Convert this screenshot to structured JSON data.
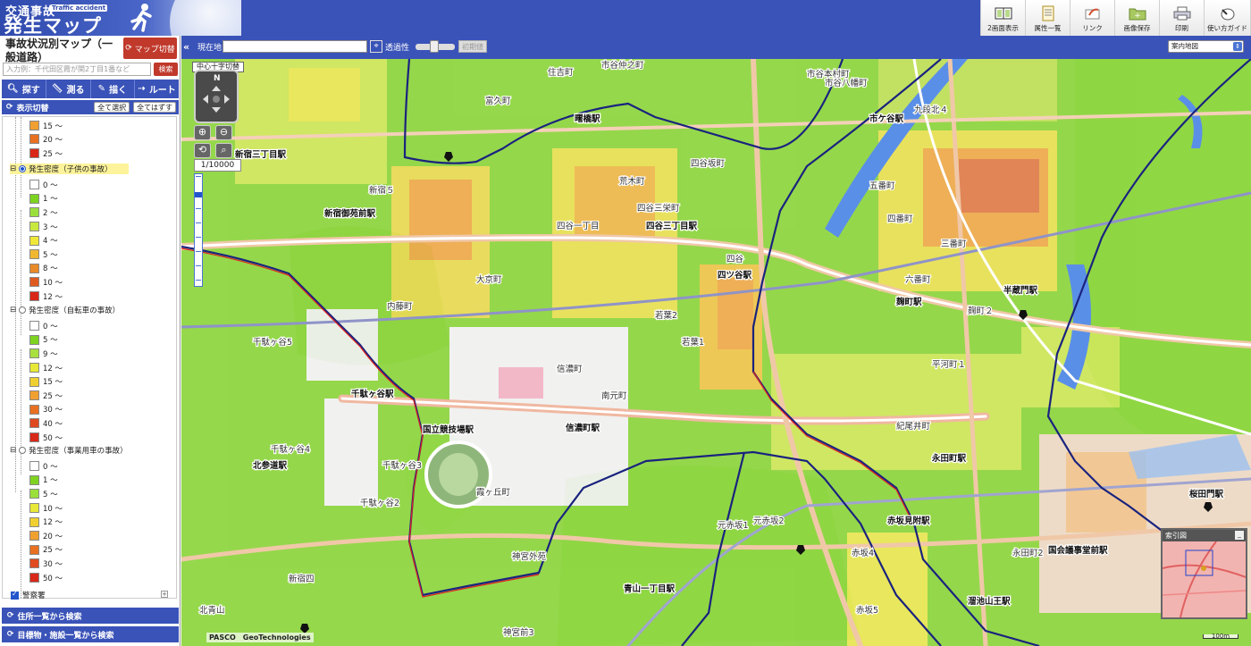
{
  "header": {
    "logo_line1": "交通事故",
    "logo_line2": "発生マップ",
    "logo_en": "Traffic accident",
    "toolbar": [
      {
        "label": "2画面表示",
        "icon": "dual-screen-icon"
      },
      {
        "label": "属性一覧",
        "icon": "attribute-list-icon"
      },
      {
        "label": "リンク",
        "icon": "link-icon"
      },
      {
        "label": "画像保存",
        "icon": "save-image-icon"
      },
      {
        "label": "印刷",
        "icon": "print-icon"
      },
      {
        "label": "使い方ガイド",
        "icon": "guide-icon"
      }
    ]
  },
  "sidebar": {
    "title": "事故状況別マップ（一般道路）",
    "map_switch_label": "マップ切替",
    "address_placeholder": "入力例：千代田区霞が関2丁目1番など",
    "search_label": "検索",
    "tools": [
      {
        "label": "探す",
        "icon": "search-icon"
      },
      {
        "label": "測る",
        "icon": "ruler-icon"
      },
      {
        "label": "描く",
        "icon": "draw-icon"
      },
      {
        "label": "ルート",
        "icon": "route-icon"
      }
    ],
    "display_toggle": {
      "label": "表示切替",
      "select_all": "全て選択",
      "deselect_all": "全てはずす"
    },
    "top_legend": [
      {
        "label": "15 〜",
        "color": "#f0a030"
      },
      {
        "label": "20 〜",
        "color": "#e87020"
      },
      {
        "label": "25 〜",
        "color": "#d82818"
      }
    ],
    "groups": [
      {
        "label": "発生密度（子供の事故）",
        "selected": true,
        "items": [
          {
            "label": "0 〜",
            "color": "#ffffff"
          },
          {
            "label": "1 〜",
            "color": "#7ed321"
          },
          {
            "label": "2 〜",
            "color": "#9be03a"
          },
          {
            "label": "3 〜",
            "color": "#c8e840"
          },
          {
            "label": "4 〜",
            "color": "#f0e838"
          },
          {
            "label": "5 〜",
            "color": "#f0b830"
          },
          {
            "label": "8 〜",
            "color": "#e88a28"
          },
          {
            "label": "10 〜",
            "color": "#e05a20"
          },
          {
            "label": "12 〜",
            "color": "#d82818"
          }
        ]
      },
      {
        "label": "発生密度（自転車の事故）",
        "selected": false,
        "items": [
          {
            "label": "0 〜",
            "color": "#ffffff"
          },
          {
            "label": "5 〜",
            "color": "#7ed321"
          },
          {
            "label": "9 〜",
            "color": "#a8e040"
          },
          {
            "label": "12 〜",
            "color": "#e8e838"
          },
          {
            "label": "15 〜",
            "color": "#f0d030"
          },
          {
            "label": "25 〜",
            "color": "#f0a030"
          },
          {
            "label": "30 〜",
            "color": "#e87020"
          },
          {
            "label": "40 〜",
            "color": "#e04a20"
          },
          {
            "label": "50 〜",
            "color": "#d82818"
          }
        ]
      },
      {
        "label": "発生密度（事業用車の事故）",
        "selected": false,
        "items": [
          {
            "label": "0 〜",
            "color": "#ffffff"
          },
          {
            "label": "1 〜",
            "color": "#7ed321"
          },
          {
            "label": "5 〜",
            "color": "#9be03a"
          },
          {
            "label": "10 〜",
            "color": "#e8e838"
          },
          {
            "label": "12 〜",
            "color": "#f0d030"
          },
          {
            "label": "20 〜",
            "color": "#f0a030"
          },
          {
            "label": "25 〜",
            "color": "#e87020"
          },
          {
            "label": "30 〜",
            "color": "#e04a20"
          },
          {
            "label": "50 〜",
            "color": "#d82818"
          }
        ]
      }
    ],
    "police_label": "警察署",
    "address_list_label": "住所一覧から検索",
    "landmark_list_label": "目標物・施設一覧から検索"
  },
  "mapbar": {
    "current_location_label": "現在地",
    "transparency_label": "透過性",
    "initial_value_label": "初期値",
    "basemap_selected": "案内地図"
  },
  "map": {
    "center_cross_label": "中心十字切替",
    "compass_label": "N",
    "scale": "1/10000",
    "copyright": [
      "PASCO",
      "GeoTechnologies"
    ],
    "index_map_label": "索引図",
    "scale_bar_label": "100m",
    "labels": [
      "市谷仲之町",
      "住吉町",
      "市谷本村町",
      "市谷八幡町",
      "九段北４",
      "曙橋駅",
      "富久町",
      "市ケ谷駅",
      "新宿三丁目駅",
      "新宿５",
      "荒木町",
      "四谷坂町",
      "五番町",
      "四谷三丁目駅",
      "新宿御苑前駅",
      "四谷三栄町",
      "四谷一丁目",
      "四番町",
      "三番町",
      "四谷",
      "四ツ谷駅",
      "大京町",
      "若葉2",
      "若葉1",
      "内藤町",
      "六番町",
      "麹町駅",
      "半蔵門駅",
      "麹町２",
      "平河町１",
      "千駄ヶ谷5",
      "信濃町",
      "南元町",
      "千駄ヶ谷駅",
      "信濃町駅",
      "紀尾井町",
      "永田町駅",
      "国立競技場駅",
      "北参道駅",
      "霞ヶ丘町",
      "元赤坂2",
      "赤坂見附駅",
      "元赤坂1",
      "赤坂4",
      "永田町2",
      "国会議事堂前駅",
      "桜田門駅",
      "溜池山王駅",
      "青山一丁目駅",
      "赤坂5",
      "千駄ヶ谷4",
      "千駄ヶ谷2",
      "千駄ヶ谷3",
      "新宿四",
      "神宮外苑",
      "神宮前3",
      "北青山"
    ]
  }
}
